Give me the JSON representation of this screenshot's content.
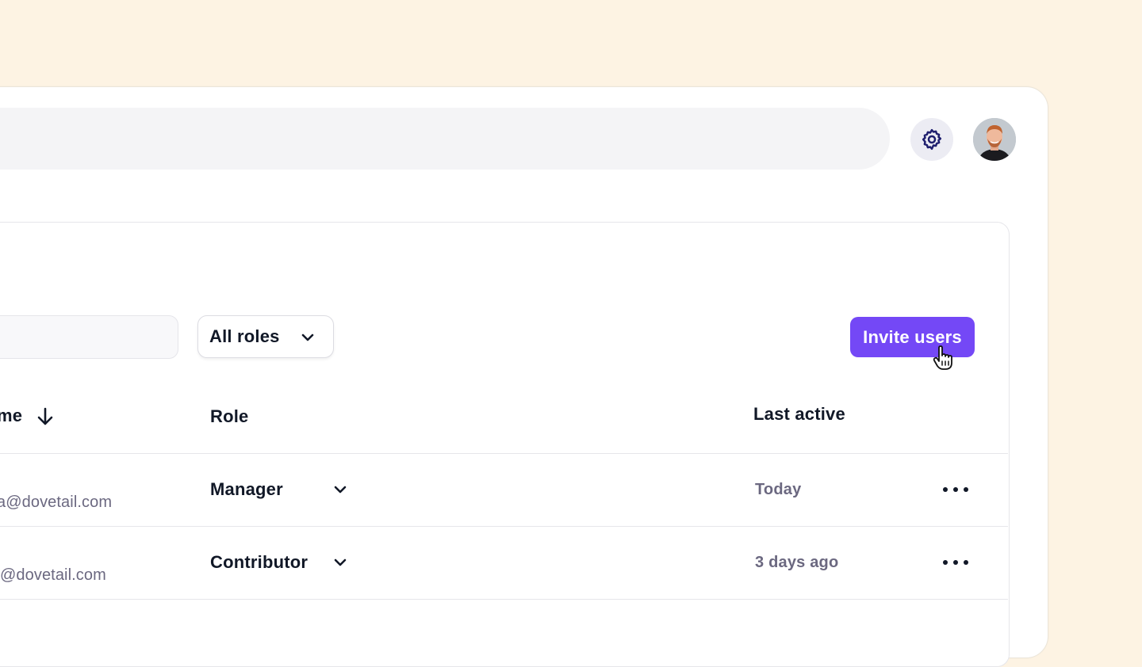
{
  "colors": {
    "background": "#fdf3e3",
    "accent": "#7448f6",
    "icon": "#1f1f6e"
  },
  "toolbar": {
    "settings_icon": "gear-icon",
    "avatar": "user-avatar"
  },
  "filters": {
    "search_placeholder": "",
    "role_select": {
      "selected": "All roles"
    },
    "invite_label": "Invite users"
  },
  "table": {
    "headers": {
      "name": "me",
      "role": "Role",
      "last_active": "Last active"
    },
    "rows": [
      {
        "email": "a@dovetail.com",
        "role": "Manager",
        "last_active": "Today"
      },
      {
        "email": "@dovetail.com",
        "role": "Contributor",
        "last_active": "3 days ago"
      }
    ]
  }
}
